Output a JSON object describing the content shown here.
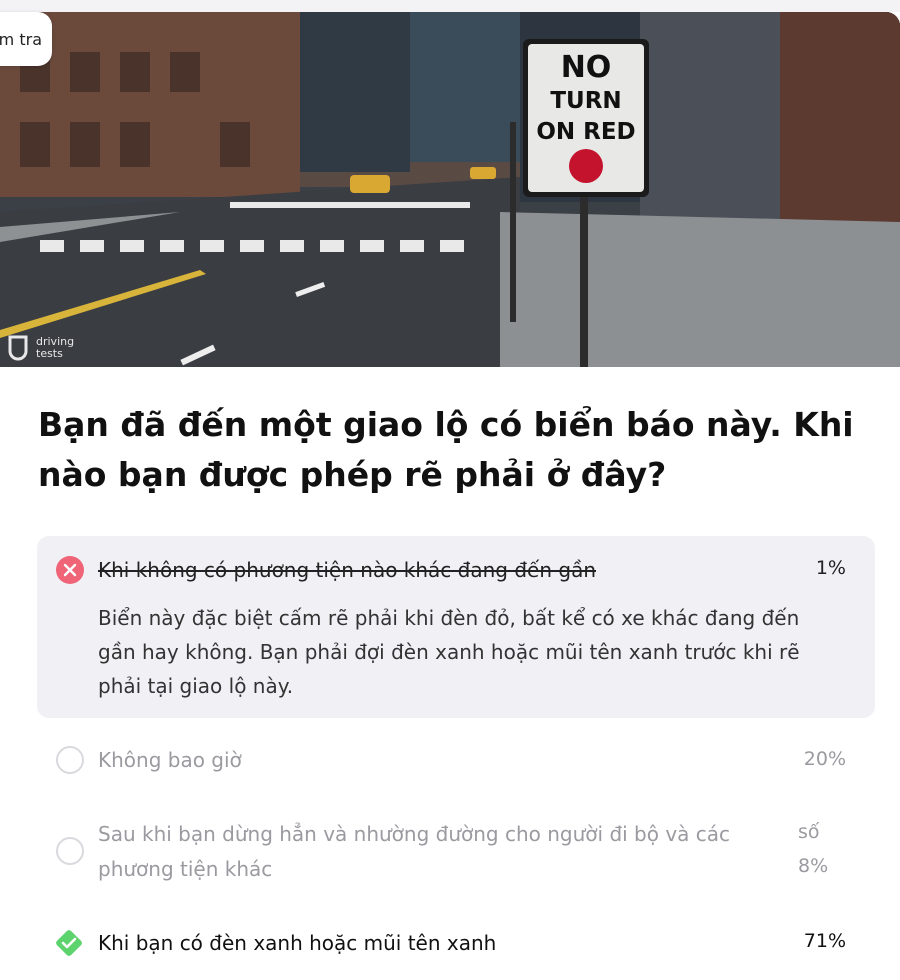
{
  "back_chip": {
    "label": "m tra"
  },
  "hero": {
    "sign_text_line1": "NO",
    "sign_text_line2": "TURN",
    "sign_text_line3": "ON RED",
    "watermark_line1": "driving",
    "watermark_line2": "tests"
  },
  "question": "Bạn đã đến một giao lộ có biển báo này. Khi nào bạn được phép rẽ phải ở đây?",
  "options": [
    {
      "label": "Khi không có phương tiện nào khác đang đến gần",
      "percent": "1%",
      "state": "wrong",
      "icon": "close-icon"
    },
    {
      "label": "Không bao giờ",
      "percent": "20%",
      "state": "unselected",
      "icon": "radio-icon"
    },
    {
      "label": "Sau khi bạn dừng hẳn và nhường đường cho người đi bộ và các phương tiện khác",
      "percent_line1": "số",
      "percent": "8%",
      "state": "unselected",
      "icon": "radio-icon"
    },
    {
      "label": "Khi bạn có đèn xanh hoặc mũi tên xanh",
      "percent": "71%",
      "state": "correct",
      "icon": "check-icon"
    }
  ],
  "explanation": "Biển này đặc biệt cấm rẽ phải khi đèn đỏ, bất kể có xe khác đang đến gần hay không. Bạn phải đợi đèn xanh hoặc mũi tên xanh trước khi rẽ phải tại giao lộ này.",
  "colors": {
    "wrong": "#ef6476",
    "correct": "#5dd36d",
    "panel": "#f1f0f5",
    "muted": "#9a9aa0"
  }
}
